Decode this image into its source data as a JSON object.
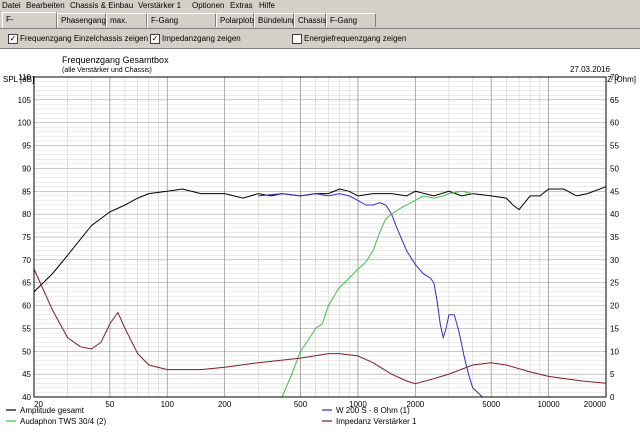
{
  "menu": [
    "Datei",
    "Bearbeiten",
    "Chassis & Einbau",
    "Verstärker 1",
    "Optionen",
    "Extras",
    "Hilfe"
  ],
  "tabs": [
    "F-Gang/Imped.",
    "Phasengang",
    "max. Pegel",
    "F-Gang Richtungen",
    "Polarplots",
    "Bündelung",
    "Chassis",
    "F-Gang elektr."
  ],
  "options": [
    {
      "label": "Frequenzgang Einzelchassis zeigen",
      "checked": true
    },
    {
      "label": "Impedanzgang zeigen",
      "checked": true
    },
    {
      "label": "Energiefrequenzgang zeigen",
      "checked": false
    }
  ],
  "colors": {
    "amplitude": "#000000",
    "woofer": "#3030c0",
    "tweeter": "#40c040",
    "impedance": "#802020",
    "grid": "#b0b0b0"
  },
  "chart_data": {
    "type": "line",
    "title": "Frequenzgang Gesamtbox",
    "subtitle": "(alle Verstärker und Chassis)",
    "date": "27.03.2016",
    "ylabel_left": "SPL [dB]",
    "ylabel_right": "Z [Ohm]",
    "x_scale": "log",
    "xlim": [
      20,
      20000
    ],
    "ylim_left": [
      40,
      110
    ],
    "ylim_right": [
      0,
      70
    ],
    "x_ticks": [
      20,
      50,
      100,
      200,
      500,
      1000,
      2000,
      5000,
      10000,
      20000
    ],
    "x_tick_labels": [
      "20",
      "50",
      "100",
      "200",
      "500",
      "1000",
      "2000",
      "5000",
      "10000",
      "20000"
    ],
    "y_ticks_left": [
      40,
      45,
      50,
      55,
      60,
      65,
      70,
      75,
      80,
      85,
      90,
      95,
      100,
      105,
      110
    ],
    "y_ticks_right": [
      0,
      5,
      10,
      15,
      20,
      25,
      30,
      35,
      40,
      45,
      50,
      55,
      60,
      65,
      70
    ],
    "grid": true,
    "series": [
      {
        "name": "Amplitude gesamt",
        "color_key": "amplitude",
        "axis": "left",
        "x": [
          20,
          25,
          30,
          40,
          50,
          60,
          70,
          80,
          100,
          120,
          150,
          200,
          250,
          300,
          350,
          400,
          500,
          600,
          700,
          800,
          900,
          1000,
          1200,
          1500,
          1800,
          2000,
          2500,
          3000,
          3500,
          4000,
          5000,
          6000,
          6500,
          7000,
          8000,
          9000,
          10000,
          12000,
          14000,
          16000,
          20000
        ],
        "y": [
          63,
          67,
          71,
          77.5,
          80.5,
          82,
          83.5,
          84.5,
          85,
          85.5,
          84.5,
          84.5,
          83.5,
          84.5,
          84,
          84.5,
          84,
          84.5,
          84.5,
          85.5,
          85,
          84,
          84.5,
          84.5,
          84,
          85,
          84,
          85,
          84,
          84.5,
          84,
          83.5,
          82,
          81,
          84,
          84,
          85.5,
          85.5,
          84,
          84.5,
          86
        ]
      },
      {
        "name": "W 200 S - 8 Ohm (1)",
        "color_key": "woofer",
        "axis": "left",
        "x": [
          300,
          400,
          500,
          600,
          700,
          800,
          900,
          1000,
          1100,
          1200,
          1300,
          1400,
          1500,
          1600,
          1800,
          2000,
          2200,
          2400,
          2500,
          2600,
          2700,
          2800,
          2900,
          3000,
          3200,
          3400,
          3600,
          3800,
          4000,
          4500,
          5000,
          6000
        ],
        "y": [
          84,
          84.5,
          84,
          84.5,
          84,
          84.5,
          84,
          83,
          82,
          82,
          82.5,
          82,
          80,
          77,
          72,
          69,
          67,
          66,
          65,
          61,
          56,
          53,
          55,
          58,
          58,
          54,
          49,
          45,
          42,
          40,
          40,
          40
        ]
      },
      {
        "name": "Audaphon TWS 30/4 (2)",
        "color_key": "tweeter",
        "axis": "left",
        "x": [
          20,
          100,
          200,
          300,
          350,
          400,
          450,
          500,
          550,
          600,
          650,
          700,
          800,
          900,
          1000,
          1100,
          1200,
          1300,
          1400,
          1500,
          1700,
          2000,
          2200,
          2500,
          2800,
          3000,
          3500,
          4000
        ],
        "y": [
          40,
          40,
          40,
          40,
          40,
          40,
          45,
          50,
          52.5,
          55,
          56,
          60,
          64,
          66,
          68,
          69.5,
          72,
          76,
          79,
          80,
          81.5,
          83,
          84,
          83.5,
          84,
          84.5,
          85,
          84.5
        ]
      },
      {
        "name": "Impedanz Verstärker 1",
        "color_key": "impedance",
        "axis": "right",
        "x": [
          20,
          25,
          30,
          35,
          40,
          45,
          50,
          55,
          60,
          70,
          80,
          100,
          120,
          150,
          200,
          300,
          500,
          700,
          800,
          1000,
          1200,
          1500,
          1800,
          2000,
          2500,
          3000,
          4000,
          5000,
          6000,
          8000,
          10000,
          15000,
          20000
        ],
        "y": [
          28,
          19,
          13,
          11,
          10.5,
          12,
          16,
          18.5,
          15,
          9.5,
          7,
          6,
          6,
          6,
          6.5,
          7.5,
          8.5,
          9.5,
          9.5,
          9,
          7.5,
          5,
          3.5,
          2.9,
          4,
          5,
          7,
          7.5,
          7,
          5.5,
          4.5,
          3.5,
          3
        ]
      }
    ]
  }
}
